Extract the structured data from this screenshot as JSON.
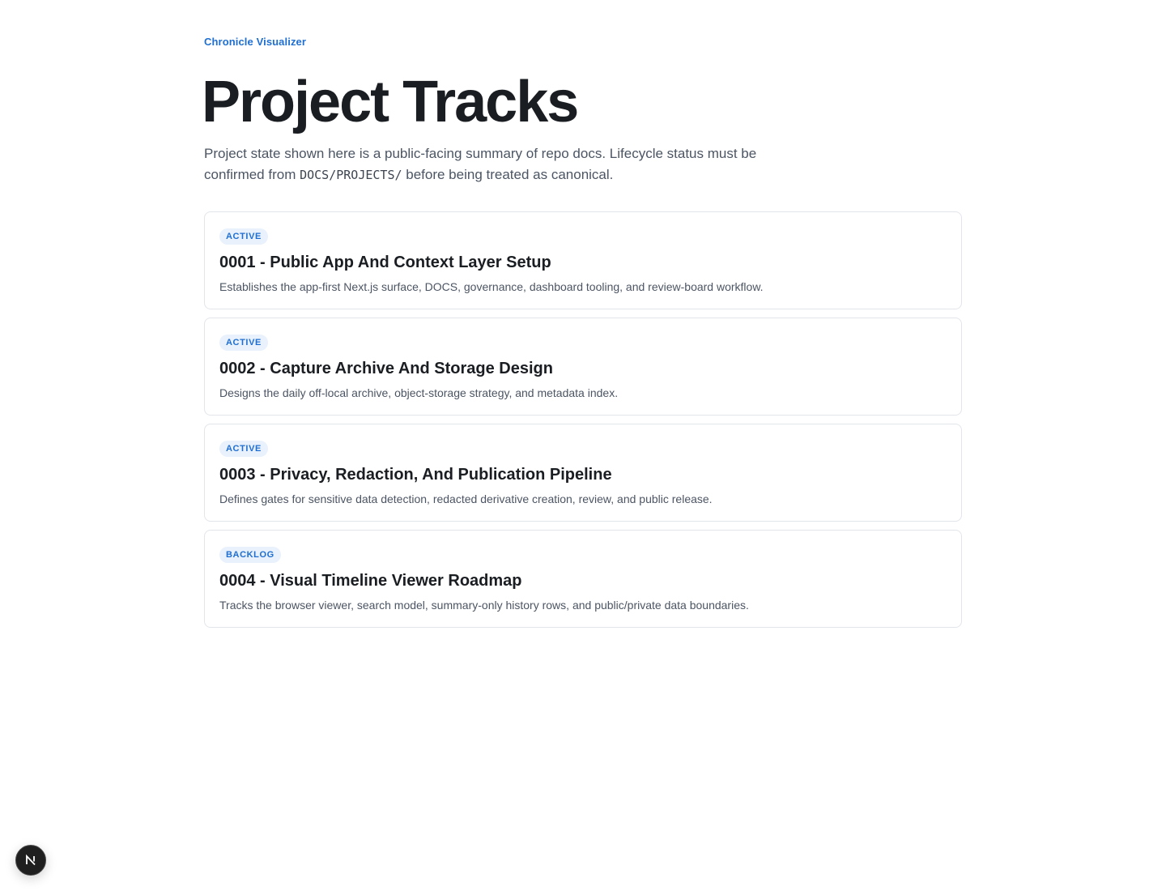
{
  "header": {
    "brand": "Chronicle Visualizer",
    "title": "Project Tracks",
    "intro_before": "Project state shown here is a public-facing summary of repo docs. Lifecycle status must be confirmed from ",
    "intro_code": "DOCS/PROJECTS/",
    "intro_after": " before being treated as canonical."
  },
  "tracks": [
    {
      "status": "ACTIVE",
      "title": "0001 - Public App And Context Layer Setup",
      "description": "Establishes the app-first Next.js surface, DOCS, governance, dashboard tooling, and review-board workflow."
    },
    {
      "status": "ACTIVE",
      "title": "0002 - Capture Archive And Storage Design",
      "description": "Designs the daily off-local archive, object-storage strategy, and metadata index."
    },
    {
      "status": "ACTIVE",
      "title": "0003 - Privacy, Redaction, And Publication Pipeline",
      "description": "Defines gates for sensitive data detection, redacted derivative creation, review, and public release."
    },
    {
      "status": "BACKLOG",
      "title": "0004 - Visual Timeline Viewer Roadmap",
      "description": "Tracks the browser viewer, search model, summary-only history rows, and public/private data boundaries."
    }
  ],
  "dev_indicator": {
    "icon": "nextjs-logo-icon"
  },
  "colors": {
    "accent": "#1f6fd1",
    "badge_bg": "#e8f1fc",
    "text": "#1a1d21",
    "muted": "#4c5563",
    "border": "#e2e5ea"
  }
}
